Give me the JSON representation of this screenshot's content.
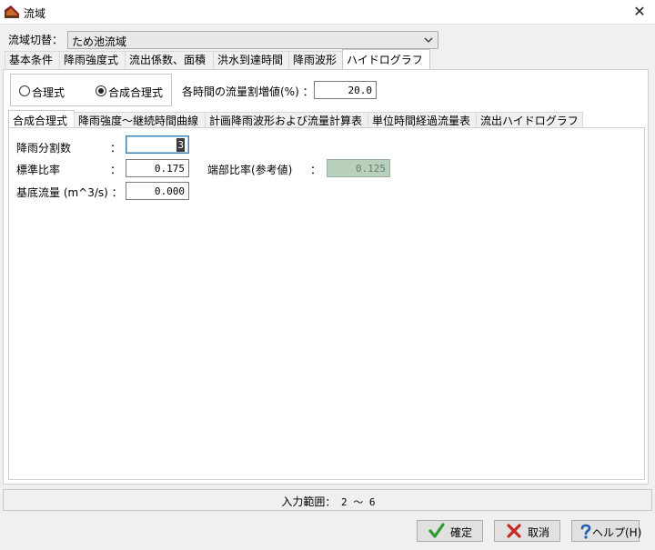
{
  "window": {
    "title": "流域",
    "close_glyph": "✕"
  },
  "basin_switch": {
    "label": "流域切替：",
    "value": "ため池流域"
  },
  "main_tabs": [
    {
      "label": "基本条件"
    },
    {
      "label": "降雨強度式"
    },
    {
      "label": "流出係数、面積"
    },
    {
      "label": "洪水到達時間"
    },
    {
      "label": "降雨波形"
    },
    {
      "label": "ハイドログラフ"
    }
  ],
  "method": {
    "options": [
      {
        "label": "合理式"
      },
      {
        "label": "合成合理式"
      }
    ],
    "selected": "合成合理式"
  },
  "flow_increase": {
    "label": "各時間の流量割増値(%) ：",
    "value": "20.0"
  },
  "sub_tabs": [
    {
      "label": "合成合理式"
    },
    {
      "label": "降雨強度～継続時間曲線"
    },
    {
      "label": "計画降雨波形および流量計算表"
    },
    {
      "label": "単位時間経過流量表"
    },
    {
      "label": "流出ハイドログラフ"
    }
  ],
  "fields": {
    "rain_division": {
      "label": "降雨分割数",
      "colon": "：",
      "value": "3"
    },
    "std_ratio": {
      "label": "標準比率",
      "colon": "：",
      "value": "0.175"
    },
    "base_flow": {
      "label": "基底流量 (m^3/s) ：",
      "value": "0.000"
    },
    "end_ratio": {
      "label": "端部比率(参考値)",
      "colon": "：",
      "value": "0.125"
    }
  },
  "status": {
    "prefix": "入力範囲",
    "range": "：  2 ～ 6"
  },
  "buttons": {
    "ok": {
      "label": "確定",
      "icon": "check-icon"
    },
    "cancel": {
      "label": "取消",
      "icon": "x-icon"
    },
    "help": {
      "label": "ヘルプ(H)",
      "icon": "question-icon"
    }
  },
  "colors": {
    "ok_icon": "#2e9b2e",
    "cancel_icon": "#c62828",
    "help_icon": "#1f5fb0",
    "reference_field_bg": "#b8d0bc"
  }
}
